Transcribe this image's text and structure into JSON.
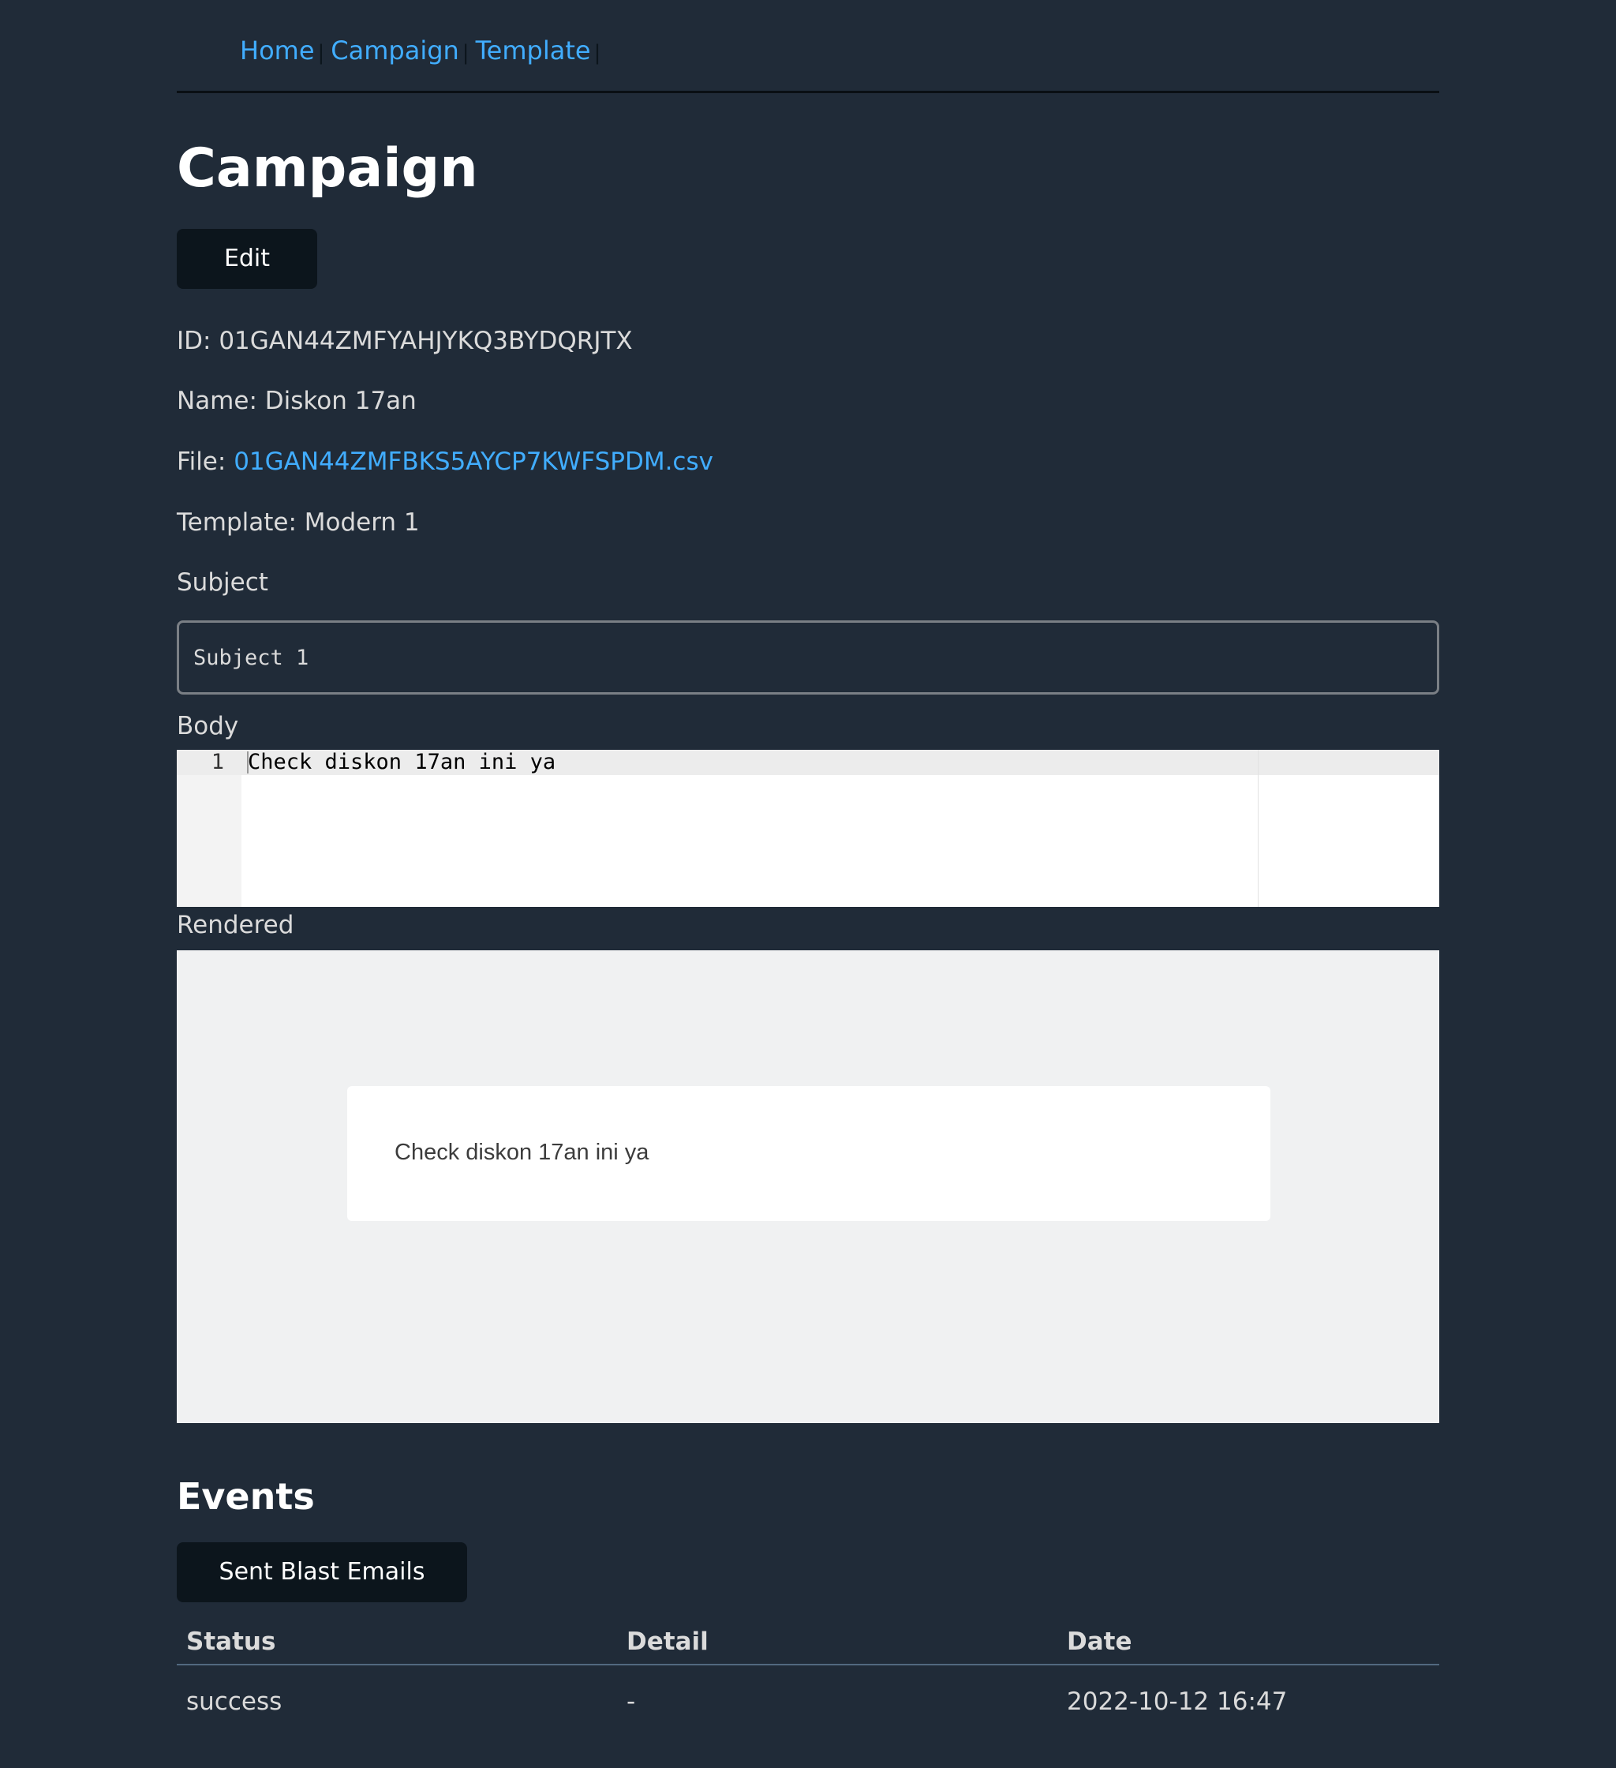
{
  "nav": {
    "items": [
      {
        "label": "Home"
      },
      {
        "label": "Campaign"
      },
      {
        "label": "Template"
      }
    ],
    "separator": "|"
  },
  "page_title": "Campaign",
  "edit_label": "Edit",
  "details": {
    "id_label": "ID:",
    "id_value": "01GAN44ZMFYAHJYKQ3BYDQRJTX",
    "name_label": "Name:",
    "name_value": "Diskon 17an",
    "file_label": "File:",
    "file_value": "01GAN44ZMFBKS5AYCP7KWFSPDM.csv",
    "template_label": "Template:",
    "template_value": "Modern 1"
  },
  "subject": {
    "label": "Subject",
    "value": "Subject 1"
  },
  "body": {
    "label": "Body",
    "lines": [
      {
        "number": "1",
        "text": "Check diskon 17an ini ya"
      }
    ]
  },
  "rendered": {
    "label": "Rendered",
    "text": "Check diskon 17an ini ya"
  },
  "events": {
    "title": "Events",
    "button_label": "Sent Blast Emails",
    "columns": [
      "Status",
      "Detail",
      "Date"
    ],
    "rows": [
      {
        "status": "success",
        "detail": "-",
        "date": "2022-10-12 16:47"
      }
    ]
  },
  "colors": {
    "background": "#202b38",
    "link": "#41adff",
    "button": "#0c151c"
  }
}
